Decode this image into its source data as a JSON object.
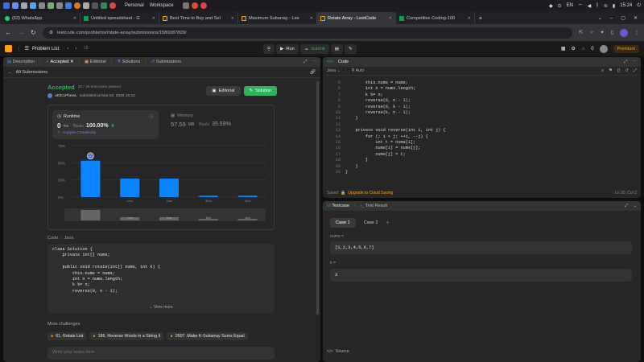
{
  "taskbar": {
    "workspace_items": [
      "Personal",
      "Workspace"
    ],
    "lang": "EN",
    "time": "15:24"
  },
  "browser_tabs": [
    {
      "label": "(63) WhatsApp",
      "color": "#25d366"
    },
    {
      "label": "Untitled spreadsheet - G",
      "color": "#0f9d58"
    },
    {
      "label": "Best Time to Buy and Sel",
      "color": "#444"
    },
    {
      "label": "Maximum Subarray - Lee",
      "color": "#444"
    },
    {
      "label": "Rotate Array - LeetCode",
      "color": "#444"
    },
    {
      "label": "Competitive Coding-100",
      "color": "#0f9d58"
    }
  ],
  "address": {
    "url": "leetcode.com/problems/rotate-array/submissions/1580087809/"
  },
  "lcnav": {
    "problem_list": "Problem List",
    "run": "Run",
    "submit": "Submit",
    "notif_count": "0",
    "premium": "Premium"
  },
  "left_tabs": [
    "Description",
    "Accepted",
    "Editorial",
    "Solutions",
    "Submissions"
  ],
  "all_submissions": "All Submissions",
  "result": {
    "status": "Accepted",
    "passed": "38 / 38 testcases passed",
    "user": "uKlC1PhewL",
    "submitted": "submitted at Mar 20, 2025 15:22",
    "editorial_btn": "Editorial",
    "solution_btn": "Solution"
  },
  "runtime": {
    "label": "Runtime",
    "value": "0",
    "unit": "ms",
    "beats_label": "Beats",
    "beats": "100.00%",
    "analyze": "Analyze Complexity"
  },
  "memory": {
    "label": "Memory",
    "value": "57.59",
    "unit": "MB",
    "beats_label": "Beats",
    "beats": "35.59%"
  },
  "chart_data": {
    "type": "bar",
    "y_ticks": [
      "75%",
      "50%",
      "25%",
      "0%"
    ],
    "categories": [
      "1ms",
      "2ms",
      "3ms",
      "4ms"
    ],
    "x_tick_labels": [
      "1ms",
      "2ms",
      "3ms",
      "4ms"
    ],
    "values": [
      53,
      27,
      27,
      2,
      2
    ],
    "ylim": [
      0,
      75
    ],
    "mini_labels": [
      "1ms",
      "2ms",
      "3ms",
      "4ms"
    ]
  },
  "code_section": {
    "label": "Code",
    "lang": "Java",
    "lines": [
      "class Solution {",
      "    private int[] nums;",
      "",
      "    public void rotate(int[] nums, int k) {",
      "        this.nums = nums;",
      "        int n = nums.length;",
      "        k %= n;",
      "        reverse(0, n - 1);"
    ],
    "view_more": "View more"
  },
  "challenges": {
    "title": "More challenges",
    "items": [
      "61. Rotate List",
      "186. Reverse Words in a String II",
      "2607. Make K-Subarray Sums Equal"
    ]
  },
  "notes_placeholder": "Write your notes here",
  "editor": {
    "title": "Code",
    "lang": "Java",
    "mode": "Auto",
    "saved": "Saved",
    "upgrade": "Upgrade to Cloud Saving",
    "cursor": "Ln 20, Col 2",
    "line_numbers": [
      "5",
      "6",
      "7",
      "8",
      "9",
      "10",
      "11",
      "12",
      "13",
      "14",
      "15",
      "16",
      "17",
      "18",
      "19",
      "20"
    ],
    "lines": [
      "        this.nums = nums;",
      "        int n = nums.length;",
      "        k %= n;",
      "        reverse(0, n - 1);",
      "        reverse(0, k - 1);",
      "        reverse(k, n - 1);",
      "    }",
      "",
      "    private void reverse(int i, int j) {",
      "        for (; i < j; ++i, --j) {",
      "            int t = nums[i];",
      "            nums[i] = nums[j];",
      "            nums[j] = t;",
      "        }",
      "    }",
      "}"
    ]
  },
  "testcase": {
    "tab1": "Testcase",
    "tab2": "Test Result",
    "case1": "Case 1",
    "case2": "Case 2",
    "add": "+",
    "var1_label": "nums =",
    "var1_value": "[1,2,3,4,5,6,7]",
    "var2_label": "k =",
    "var2_value": "3",
    "source": "Source"
  },
  "colors": {
    "accent_green": "#2db55d",
    "bar_blue": "#0a84ff",
    "premium": "#ffa116"
  }
}
